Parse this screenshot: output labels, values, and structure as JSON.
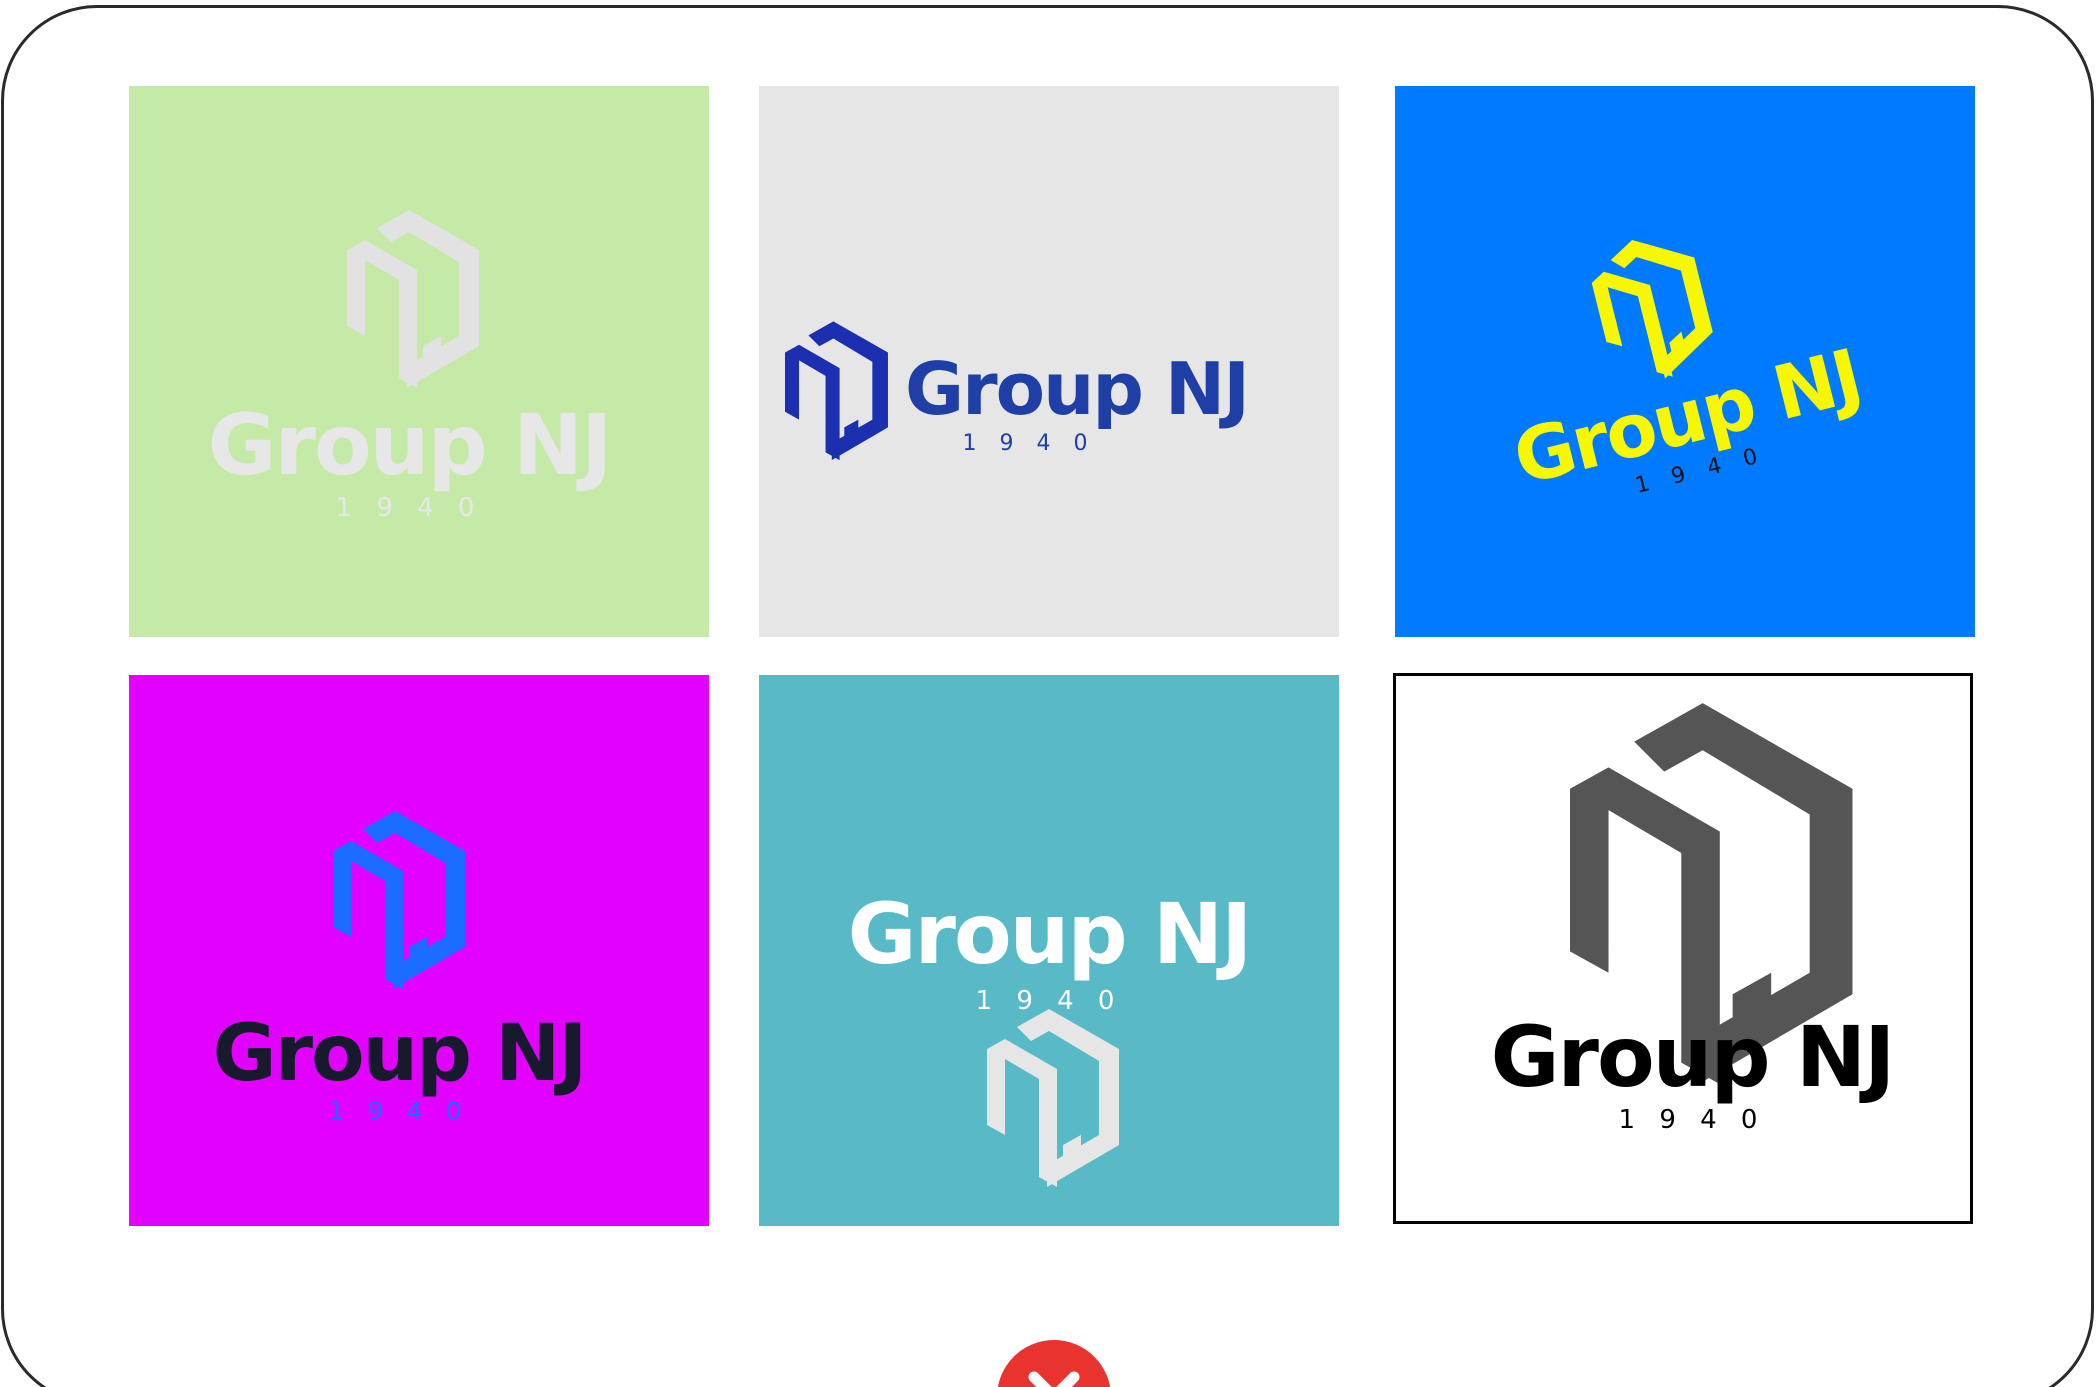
{
  "logo": {
    "brand": "Group NJ",
    "year": "1 9 4 0"
  },
  "tiles": [
    {
      "background": "#c5eaa8",
      "mark_color": "#e2e2e2",
      "text_color": "#e7e7e7",
      "year_color": "#e7e7e7"
    },
    {
      "background": "#e6e6e6",
      "mark_color": "#1b2fb0",
      "text_color": "#1f3fa6",
      "year_color": "#1f3fa6"
    },
    {
      "background": "#007bff",
      "mark_color": "#f7f700",
      "text_color": "#f7f700",
      "year_color": "#111111"
    },
    {
      "background": "#e200ff",
      "mark_color": "#1a6cff",
      "text_color": "#161a2c",
      "year_color": "#1a6cff"
    },
    {
      "background": "#57bac6",
      "mark_color": "#e6e6e6",
      "text_color": "#ffffff",
      "year_color": "#ffffff"
    },
    {
      "background": "#ffffff",
      "mark_color": "#555555",
      "text_color": "#000000",
      "year_color": "#000000"
    }
  ],
  "close_icon": "close-icon",
  "accent_color": "#e8332f"
}
